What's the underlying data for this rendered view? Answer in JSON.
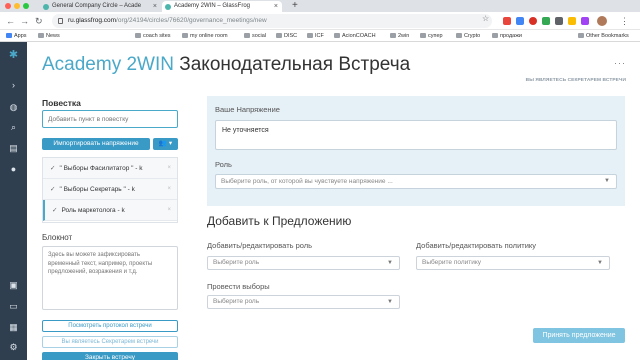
{
  "browser": {
    "tabs": [
      {
        "title": "General Company Circle – Acade"
      },
      {
        "title": "Academy 2WIN – GlassFrog"
      }
    ],
    "url_host": "ru.glassfrog.com",
    "url_path": "/org/24194/circles/76620/governance_meetings/new",
    "bookmarks": [
      "Apps",
      "News",
      "coach sites",
      "my online room",
      "social",
      "DISC",
      "ICF",
      "AcionCOACH",
      "2win",
      "супер",
      "Crypto",
      "продажи",
      "Other Bookmarks"
    ]
  },
  "header": {
    "brand": "Academy 2WIN",
    "title": "Законодательная Встреча",
    "secretary_note": "ВЫ ЯВЛЯЕТЕСЬ СЕКРЕТАРЕМ ВСТРЕЧИ"
  },
  "agenda": {
    "title": "Повестка",
    "placeholder": "Добавить пункт в повестку",
    "import_label": "Импортировать напряжение",
    "items": [
      {
        "label": "\" Выборы Фасилитатор \" - k"
      },
      {
        "label": "\" Выборы Секретарь \" - k"
      },
      {
        "label": "Роль маркетолога - k"
      }
    ]
  },
  "notes": {
    "title": "Блокнот",
    "placeholder": "Здесь вы можете зафиксировать временный текст, например, проекты предложений, возражения и т.д."
  },
  "buttons": {
    "view_minutes": "Посмотреть протокол встречи",
    "secretary": "Вы являетесь Секретарем встречи",
    "end_meeting": "Закрыть встречу",
    "submit": "Принять предложение"
  },
  "tension": {
    "label": "Ваше Напряжение",
    "value": "Не уточняется",
    "role_label": "Роль",
    "role_placeholder": "Выберите роль, от которой вы чувствуете напряжение ..."
  },
  "proposal": {
    "title": "Добавить к Предложению",
    "edit_role_label": "Добавить/редактировать роль",
    "edit_role_placeholder": "Выберите роль",
    "edit_policy_label": "Добавить/редактировать политику",
    "edit_policy_placeholder": "Выберите политику",
    "elections_label": "Провести выборы",
    "elections_placeholder": "Выберите роль"
  }
}
